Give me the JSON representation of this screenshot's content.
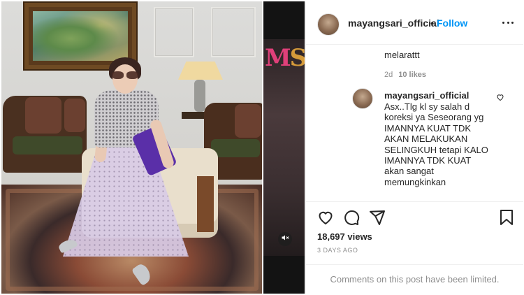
{
  "post": {
    "username": "mayangsari_official",
    "separator": "•",
    "follow_label": "Follow",
    "more_icon": "more-options-icon"
  },
  "video": {
    "logo_text_m": "M",
    "logo_text_rest": "ST",
    "mute_icon": "muted-speaker-icon"
  },
  "comments": {
    "previous_reply_tail": "melarattt",
    "previous_reply_age": "2d",
    "previous_reply_likes": "10 likes",
    "comment": {
      "username": "mayangsari_official",
      "lines": [
        "Asx..Tlg kl sy salah d",
        "koreksi ya Seseorang yg",
        "IMANNYA KUAT TDK",
        "AKAN MELAKUKAN",
        "SELINGKUH tetapi KALO",
        "IMANNYA TDK KUAT",
        "akan sangat",
        "memungkinkan"
      ]
    }
  },
  "actions": {
    "like_icon": "heart-icon",
    "comment_icon": "comment-icon",
    "share_icon": "share-icon",
    "save_icon": "bookmark-icon",
    "views": "18,697 views",
    "date": "3 DAYS AGO"
  },
  "footer": {
    "limited_text": "Comments on this post have been limited."
  },
  "colors": {
    "link_blue": "#0095f6",
    "text": "#262626",
    "muted": "#8e8e8e",
    "border": "#efefef"
  }
}
